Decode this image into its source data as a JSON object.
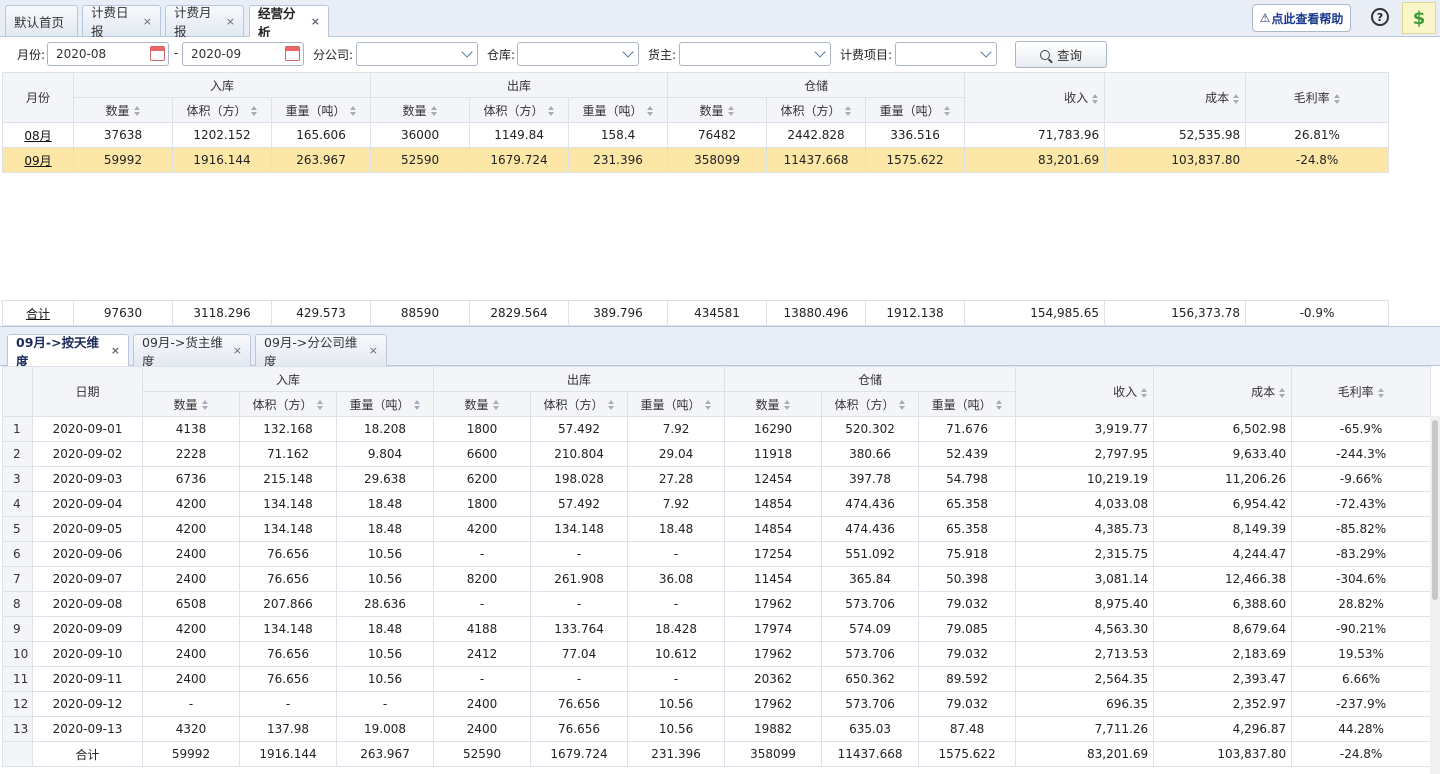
{
  "top_tabs": [
    {
      "label": "默认首页",
      "closable": false
    },
    {
      "label": "计费日报",
      "closable": true
    },
    {
      "label": "计费月报",
      "closable": true
    },
    {
      "label": "经营分析",
      "closable": true,
      "active": true
    }
  ],
  "close_glyph": "×",
  "help_label": "点此查看帮助",
  "help_icon_glyph": "⚠",
  "question_glyph": "?",
  "money_glyph": "$",
  "filters": {
    "month_label": "月份:",
    "month_from": "2020-08",
    "dash": "-",
    "month_to": "2020-09",
    "branch_label": "分公司:",
    "branch_value": "",
    "warehouse_label": "仓库:",
    "warehouse_value": "",
    "owner_label": "货主:",
    "owner_value": "",
    "item_label": "计费项目:",
    "item_value": "",
    "query_label": "查询"
  },
  "headers": {
    "month": "月份",
    "date": "日期",
    "in": "入库",
    "out": "出库",
    "storage": "仓储",
    "qty": "数量",
    "vol": "体积（方）",
    "wt": "重量（吨）",
    "income": "收入",
    "cost": "成本",
    "margin": "毛利率"
  },
  "summary_rows": [
    {
      "month": "08月",
      "in_qty": "37638",
      "in_vol": "1202.152",
      "in_wt": "165.606",
      "out_qty": "36000",
      "out_vol": "1149.84",
      "out_wt": "158.4",
      "st_qty": "76482",
      "st_vol": "2442.828",
      "st_wt": "336.516",
      "income": "71,783.96",
      "cost": "52,535.98",
      "margin": "26.81%"
    },
    {
      "month": "09月",
      "in_qty": "59992",
      "in_vol": "1916.144",
      "in_wt": "263.967",
      "out_qty": "52590",
      "out_vol": "1679.724",
      "out_wt": "231.396",
      "st_qty": "358099",
      "st_vol": "11437.668",
      "st_wt": "1575.622",
      "income": "83,201.69",
      "cost": "103,837.80",
      "margin": "-24.8%",
      "selected": true
    }
  ],
  "summary_total": {
    "label": "合计",
    "in_qty": "97630",
    "in_vol": "3118.296",
    "in_wt": "429.573",
    "out_qty": "88590",
    "out_vol": "2829.564",
    "out_wt": "389.796",
    "st_qty": "434581",
    "st_vol": "13880.496",
    "st_wt": "1912.138",
    "income": "154,985.65",
    "cost": "156,373.78",
    "margin": "-0.9%"
  },
  "bottom_tabs": [
    {
      "label": "09月->按天维度",
      "active": true
    },
    {
      "label": "09月->货主维度"
    },
    {
      "label": "09月->分公司维度"
    }
  ],
  "daily_rows": [
    {
      "n": "1",
      "date": "2020-09-01",
      "in_qty": "4138",
      "in_vol": "132.168",
      "in_wt": "18.208",
      "out_qty": "1800",
      "out_vol": "57.492",
      "out_wt": "7.92",
      "st_qty": "16290",
      "st_vol": "520.302",
      "st_wt": "71.676",
      "income": "3,919.77",
      "cost": "6,502.98",
      "margin": "-65.9%"
    },
    {
      "n": "2",
      "date": "2020-09-02",
      "in_qty": "2228",
      "in_vol": "71.162",
      "in_wt": "9.804",
      "out_qty": "6600",
      "out_vol": "210.804",
      "out_wt": "29.04",
      "st_qty": "11918",
      "st_vol": "380.66",
      "st_wt": "52.439",
      "income": "2,797.95",
      "cost": "9,633.40",
      "margin": "-244.3%"
    },
    {
      "n": "3",
      "date": "2020-09-03",
      "in_qty": "6736",
      "in_vol": "215.148",
      "in_wt": "29.638",
      "out_qty": "6200",
      "out_vol": "198.028",
      "out_wt": "27.28",
      "st_qty": "12454",
      "st_vol": "397.78",
      "st_wt": "54.798",
      "income": "10,219.19",
      "cost": "11,206.26",
      "margin": "-9.66%"
    },
    {
      "n": "4",
      "date": "2020-09-04",
      "in_qty": "4200",
      "in_vol": "134.148",
      "in_wt": "18.48",
      "out_qty": "1800",
      "out_vol": "57.492",
      "out_wt": "7.92",
      "st_qty": "14854",
      "st_vol": "474.436",
      "st_wt": "65.358",
      "income": "4,033.08",
      "cost": "6,954.42",
      "margin": "-72.43%"
    },
    {
      "n": "5",
      "date": "2020-09-05",
      "in_qty": "4200",
      "in_vol": "134.148",
      "in_wt": "18.48",
      "out_qty": "4200",
      "out_vol": "134.148",
      "out_wt": "18.48",
      "st_qty": "14854",
      "st_vol": "474.436",
      "st_wt": "65.358",
      "income": "4,385.73",
      "cost": "8,149.39",
      "margin": "-85.82%"
    },
    {
      "n": "6",
      "date": "2020-09-06",
      "in_qty": "2400",
      "in_vol": "76.656",
      "in_wt": "10.56",
      "out_qty": "-",
      "out_vol": "-",
      "out_wt": "-",
      "st_qty": "17254",
      "st_vol": "551.092",
      "st_wt": "75.918",
      "income": "2,315.75",
      "cost": "4,244.47",
      "margin": "-83.29%"
    },
    {
      "n": "7",
      "date": "2020-09-07",
      "in_qty": "2400",
      "in_vol": "76.656",
      "in_wt": "10.56",
      "out_qty": "8200",
      "out_vol": "261.908",
      "out_wt": "36.08",
      "st_qty": "11454",
      "st_vol": "365.84",
      "st_wt": "50.398",
      "income": "3,081.14",
      "cost": "12,466.38",
      "margin": "-304.6%"
    },
    {
      "n": "8",
      "date": "2020-09-08",
      "in_qty": "6508",
      "in_vol": "207.866",
      "in_wt": "28.636",
      "out_qty": "-",
      "out_vol": "-",
      "out_wt": "-",
      "st_qty": "17962",
      "st_vol": "573.706",
      "st_wt": "79.032",
      "income": "8,975.40",
      "cost": "6,388.60",
      "margin": "28.82%"
    },
    {
      "n": "9",
      "date": "2020-09-09",
      "in_qty": "4200",
      "in_vol": "134.148",
      "in_wt": "18.48",
      "out_qty": "4188",
      "out_vol": "133.764",
      "out_wt": "18.428",
      "st_qty": "17974",
      "st_vol": "574.09",
      "st_wt": "79.085",
      "income": "4,563.30",
      "cost": "8,679.64",
      "margin": "-90.21%"
    },
    {
      "n": "10",
      "date": "2020-09-10",
      "in_qty": "2400",
      "in_vol": "76.656",
      "in_wt": "10.56",
      "out_qty": "2412",
      "out_vol": "77.04",
      "out_wt": "10.612",
      "st_qty": "17962",
      "st_vol": "573.706",
      "st_wt": "79.032",
      "income": "2,713.53",
      "cost": "2,183.69",
      "margin": "19.53%"
    },
    {
      "n": "11",
      "date": "2020-09-11",
      "in_qty": "2400",
      "in_vol": "76.656",
      "in_wt": "10.56",
      "out_qty": "-",
      "out_vol": "-",
      "out_wt": "-",
      "st_qty": "20362",
      "st_vol": "650.362",
      "st_wt": "89.592",
      "income": "2,564.35",
      "cost": "2,393.47",
      "margin": "6.66%"
    },
    {
      "n": "12",
      "date": "2020-09-12",
      "in_qty": "-",
      "in_vol": "-",
      "in_wt": "-",
      "out_qty": "2400",
      "out_vol": "76.656",
      "out_wt": "10.56",
      "st_qty": "17962",
      "st_vol": "573.706",
      "st_wt": "79.032",
      "income": "696.35",
      "cost": "2,352.97",
      "margin": "-237.9%"
    },
    {
      "n": "13",
      "date": "2020-09-13",
      "in_qty": "4320",
      "in_vol": "137.98",
      "in_wt": "19.008",
      "out_qty": "2400",
      "out_vol": "76.656",
      "out_wt": "10.56",
      "st_qty": "19882",
      "st_vol": "635.03",
      "st_wt": "87.48",
      "income": "7,711.26",
      "cost": "4,296.87",
      "margin": "44.28%"
    }
  ],
  "daily_total": {
    "label": "合计",
    "in_qty": "59992",
    "in_vol": "1916.144",
    "in_wt": "263.967",
    "out_qty": "52590",
    "out_vol": "1679.724",
    "out_wt": "231.396",
    "st_qty": "358099",
    "st_vol": "11437.668",
    "st_wt": "1575.622",
    "income": "83,201.69",
    "cost": "103,837.80",
    "margin": "-24.8%"
  }
}
